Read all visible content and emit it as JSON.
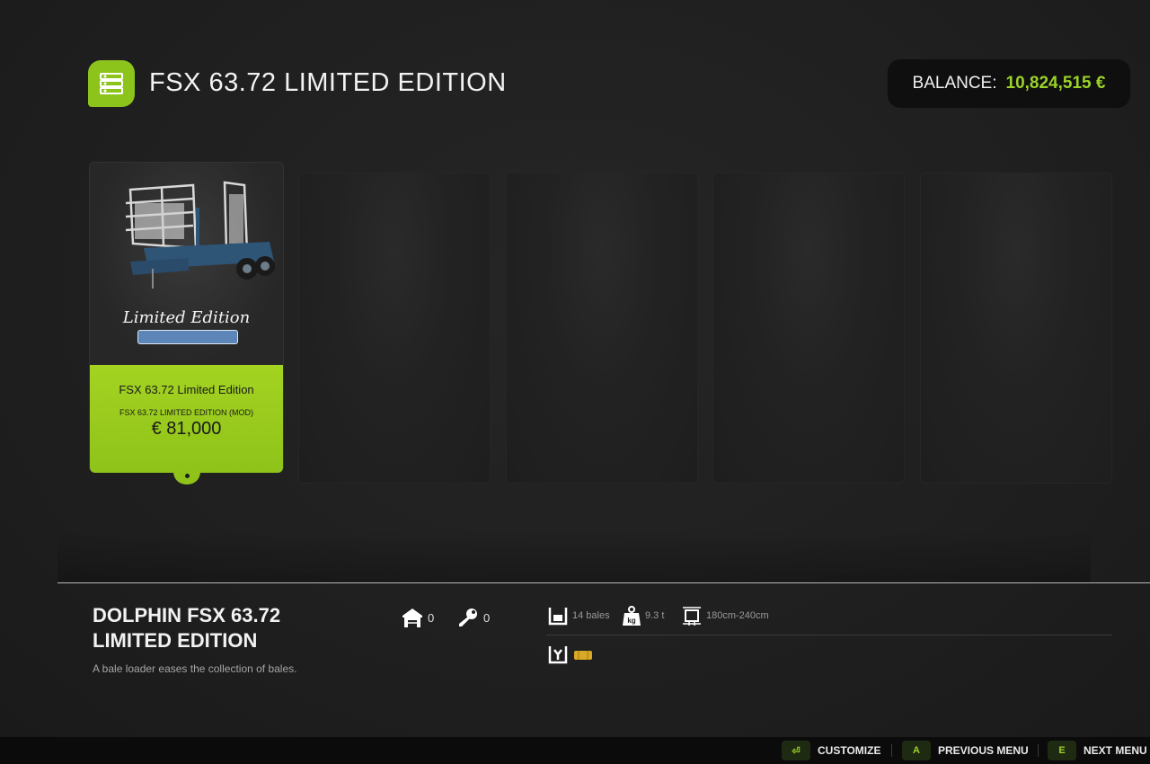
{
  "header": {
    "title": "FSX 63.72 LIMITED EDITION",
    "category_icon": "bale-loader-category-icon"
  },
  "balance": {
    "label": "BALANCE:",
    "value": "10,824,515 €"
  },
  "colors": {
    "accent": "#9bd22a",
    "card_green": "#a4d321",
    "background": "#202020"
  },
  "items": [
    {
      "logo_text": "Limited Edition",
      "name": "FSX 63.72 Limited Edition",
      "subtitle": "FSX 63.72 LIMITED EDITION (MOD)",
      "price": "€ 81,000",
      "selected": true
    }
  ],
  "empty_slots": 4,
  "detail": {
    "title": "DOLPHIN FSX 63.72 LIMITED EDITION",
    "description": "A bale loader eases the collection of bales.",
    "owned": "0",
    "leased": "0",
    "specs": {
      "capacity": "14 bales",
      "weight": "9.3 t",
      "bale_size": "180cm-240cm"
    }
  },
  "footer": {
    "customize": {
      "key": "⏎",
      "label": "CUSTOMIZE"
    },
    "previous": {
      "key": "A",
      "label": "PREVIOUS MENU"
    },
    "next": {
      "key": "E",
      "label": "NEXT MENU"
    }
  }
}
